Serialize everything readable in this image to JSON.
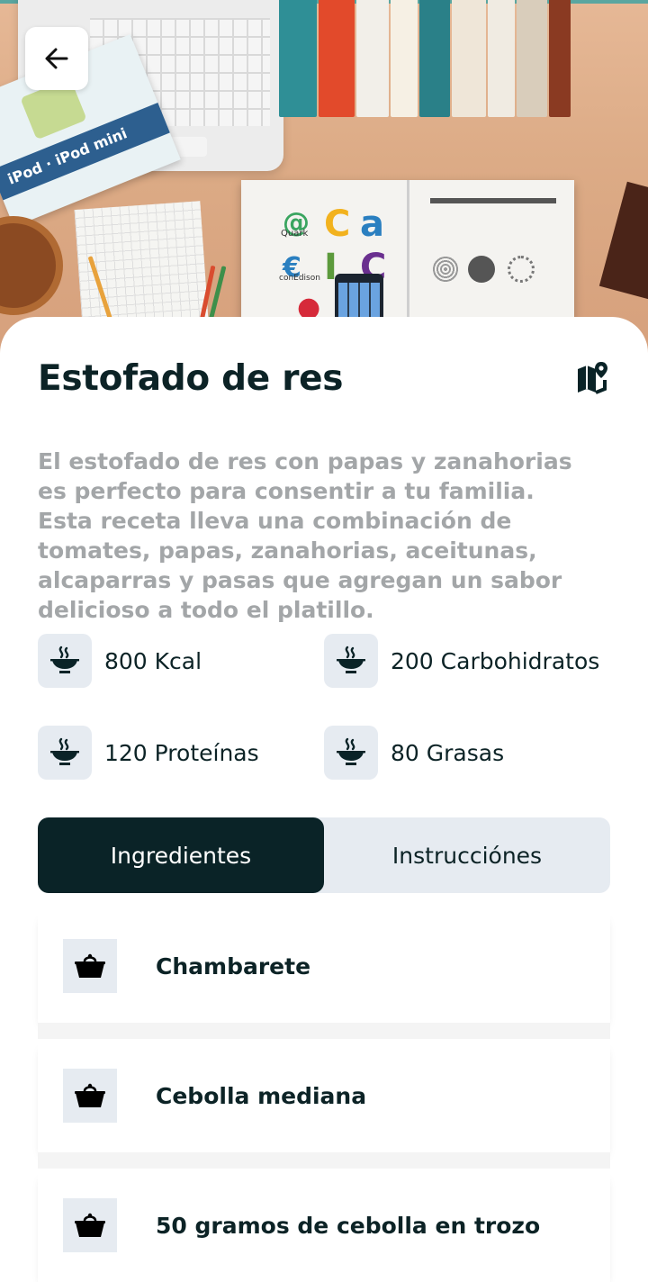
{
  "recipe": {
    "title": "Estofado de res",
    "description": "El estofado de res con papas y zanahorias es perfecto para consentir a tu familia. Esta receta lleva una combinación de tomates, papas, zanahorias, aceitunas, alcaparras y pasas que agregan un sabor delicioso a todo el platillo."
  },
  "nutrition": [
    {
      "label": "800 Kcal",
      "icon": "food-plate-icon"
    },
    {
      "label": "200 Carbohidratos",
      "icon": "food-plate-icon"
    },
    {
      "label": "120 Proteínas",
      "icon": "food-plate-icon"
    },
    {
      "label": "80 Grasas",
      "icon": "food-plate-icon"
    }
  ],
  "tabs": {
    "ingredients": "Ingredientes",
    "instructions": "Instrucciónes",
    "active": "ingredients"
  },
  "ingredients": [
    {
      "name": "Chambarete",
      "icon": "basket-icon"
    },
    {
      "name": "Cebolla mediana",
      "icon": "basket-icon"
    },
    {
      "name": "50 gramos de cebolla en trozo",
      "icon": "basket-icon"
    }
  ],
  "hero_logo_text": {
    "quark": "Quark",
    "conedison": "conEdison",
    "ipod": "iPod · iPod mini"
  },
  "colors": {
    "primary_dark": "#0a2327",
    "icon_bg": "#e6ebf1",
    "muted_text": "#a3a6a8"
  }
}
